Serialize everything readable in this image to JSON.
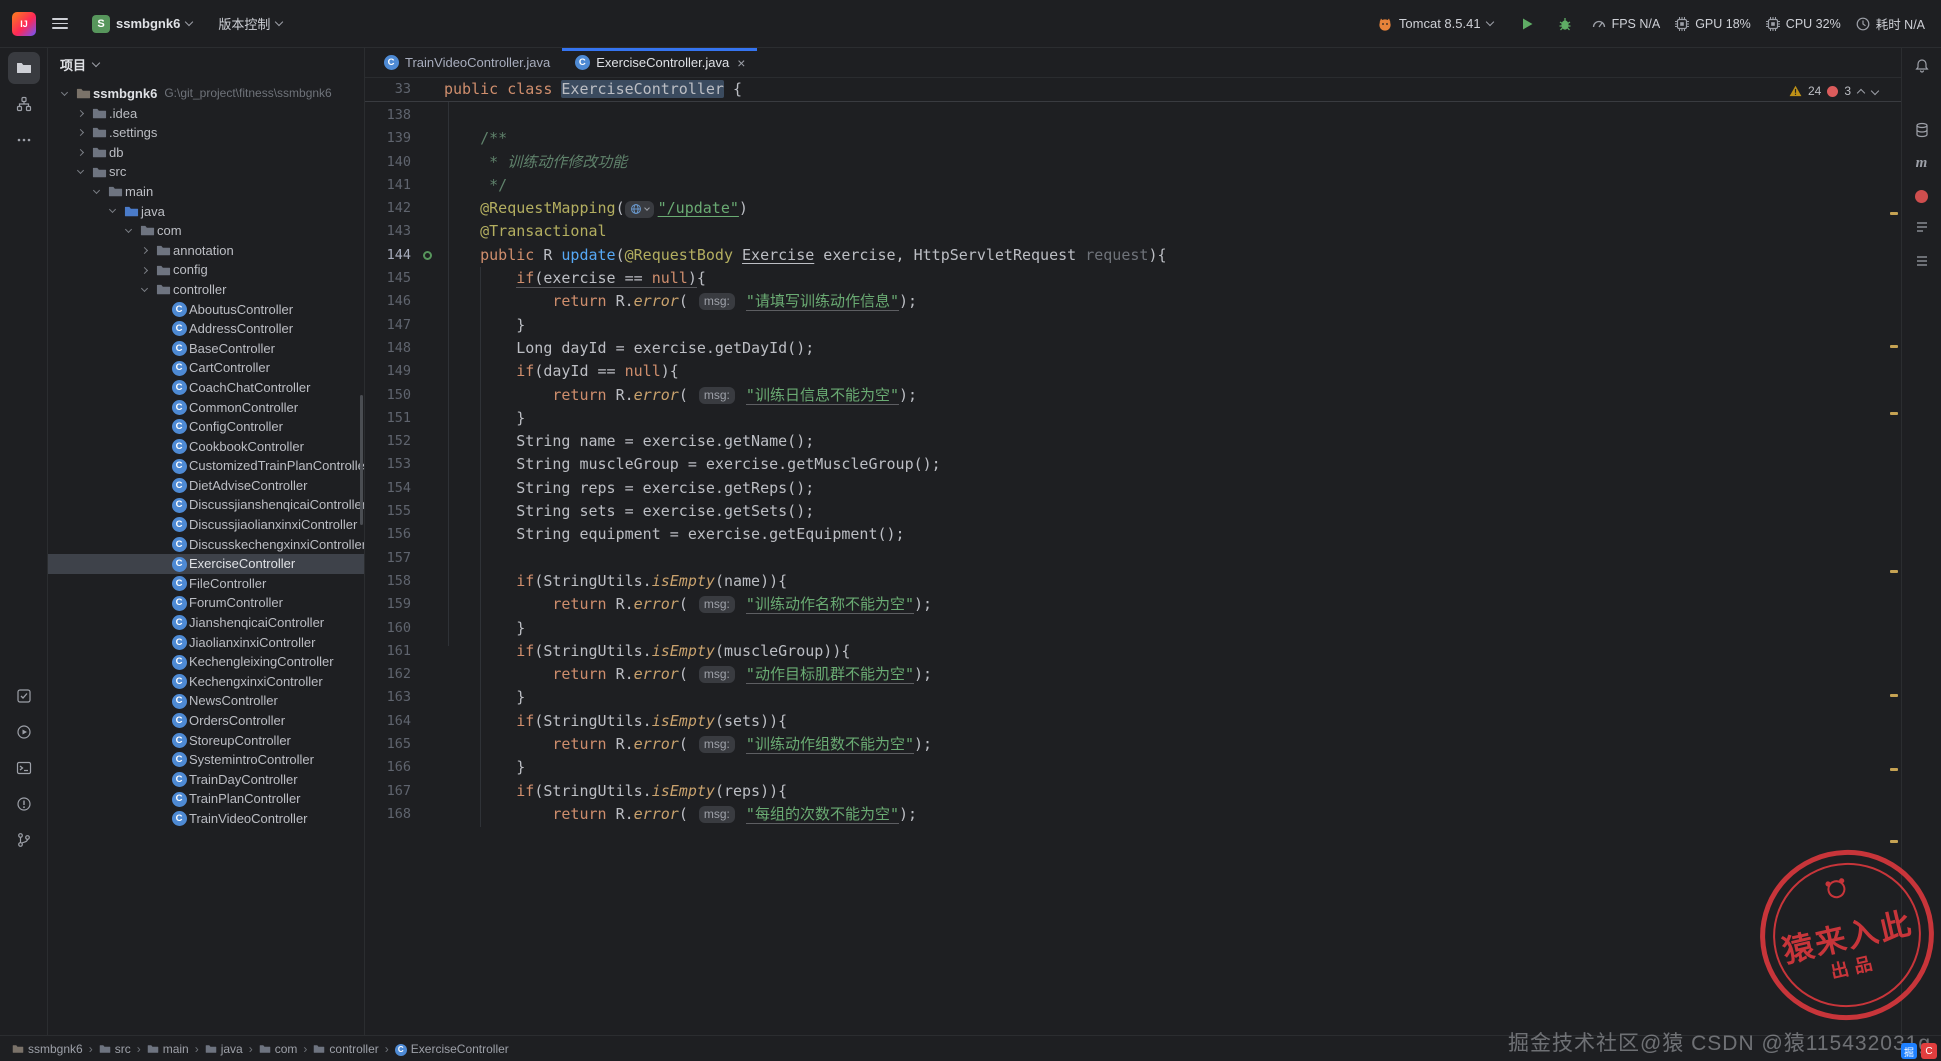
{
  "titlebar": {
    "project": "ssmbgnk6",
    "project_initial": "S",
    "vcs": "版本控制",
    "run_config": "Tomcat 8.5.41",
    "metrics": {
      "fps": "FPS N/A",
      "gpu": "GPU 18%",
      "cpu": "CPU 32%",
      "time": "耗时 N/A"
    }
  },
  "project_panel": {
    "header": "项目",
    "tree": [
      {
        "label": "ssmbgnk6",
        "lvl": 0,
        "icon": "module",
        "ch": "v",
        "bold": true,
        "extra": "G:\\git_project\\fitness\\ssmbgnk6"
      },
      {
        "label": ".idea",
        "lvl": 1,
        "icon": "folder",
        "ch": ">"
      },
      {
        "label": ".settings",
        "lvl": 1,
        "icon": "folder",
        "ch": ">"
      },
      {
        "label": "db",
        "lvl": 1,
        "icon": "folder",
        "ch": ">"
      },
      {
        "label": "src",
        "lvl": 1,
        "icon": "folder",
        "ch": "v"
      },
      {
        "label": "main",
        "lvl": 2,
        "icon": "folder",
        "ch": "v"
      },
      {
        "label": "java",
        "lvl": 3,
        "icon": "srcfolder",
        "ch": "v"
      },
      {
        "label": "com",
        "lvl": 4,
        "icon": "folder",
        "ch": "v"
      },
      {
        "label": "annotation",
        "lvl": 5,
        "icon": "folder",
        "ch": ">"
      },
      {
        "label": "config",
        "lvl": 5,
        "icon": "folder",
        "ch": ">"
      },
      {
        "label": "controller",
        "lvl": 5,
        "icon": "folder",
        "ch": "v"
      },
      {
        "label": "AboutusController",
        "lvl": 6,
        "icon": "class"
      },
      {
        "label": "AddressController",
        "lvl": 6,
        "icon": "class"
      },
      {
        "label": "BaseController",
        "lvl": 6,
        "icon": "class"
      },
      {
        "label": "CartController",
        "lvl": 6,
        "icon": "class"
      },
      {
        "label": "CoachChatController",
        "lvl": 6,
        "icon": "class"
      },
      {
        "label": "CommonController",
        "lvl": 6,
        "icon": "class"
      },
      {
        "label": "ConfigController",
        "lvl": 6,
        "icon": "class"
      },
      {
        "label": "CookbookController",
        "lvl": 6,
        "icon": "class"
      },
      {
        "label": "CustomizedTrainPlanController",
        "lvl": 6,
        "icon": "class"
      },
      {
        "label": "DietAdviseController",
        "lvl": 6,
        "icon": "class"
      },
      {
        "label": "DiscussjianshenqicaiController",
        "lvl": 6,
        "icon": "class"
      },
      {
        "label": "DiscussjiaolianxinxiController",
        "lvl": 6,
        "icon": "class"
      },
      {
        "label": "DiscusskechengxinxiController",
        "lvl": 6,
        "icon": "class"
      },
      {
        "label": "ExerciseController",
        "lvl": 6,
        "icon": "class",
        "sel": true
      },
      {
        "label": "FileController",
        "lvl": 6,
        "icon": "class"
      },
      {
        "label": "ForumController",
        "lvl": 6,
        "icon": "class"
      },
      {
        "label": "JianshenqicaiController",
        "lvl": 6,
        "icon": "class"
      },
      {
        "label": "JiaolianxinxiController",
        "lvl": 6,
        "icon": "class"
      },
      {
        "label": "KechengleixingController",
        "lvl": 6,
        "icon": "class"
      },
      {
        "label": "KechengxinxiController",
        "lvl": 6,
        "icon": "class"
      },
      {
        "label": "NewsController",
        "lvl": 6,
        "icon": "class"
      },
      {
        "label": "OrdersController",
        "lvl": 6,
        "icon": "class"
      },
      {
        "label": "StoreupController",
        "lvl": 6,
        "icon": "class"
      },
      {
        "label": "SystemintroController",
        "lvl": 6,
        "icon": "class"
      },
      {
        "label": "TrainDayController",
        "lvl": 6,
        "icon": "class"
      },
      {
        "label": "TrainPlanController",
        "lvl": 6,
        "icon": "class"
      },
      {
        "label": "TrainVideoController",
        "lvl": 6,
        "icon": "class"
      }
    ]
  },
  "tabs": [
    {
      "label": "TrainVideoController.java",
      "active": false
    },
    {
      "label": "ExerciseController.java",
      "active": true
    }
  ],
  "editor": {
    "inspections": {
      "warnings": "24",
      "errors": "3"
    },
    "sticky": {
      "n": "33",
      "s": [
        [
          "public",
          "k"
        ],
        [
          " ",
          "d"
        ],
        [
          "class",
          "k"
        ],
        [
          " ",
          "d"
        ],
        [
          "ExerciseController",
          "d hl"
        ],
        [
          " {",
          "d"
        ]
      ]
    },
    "stripe_marks": [
      164,
      297,
      364,
      522,
      646,
      720,
      792
    ],
    "lines": [
      {
        "n": "138",
        "s": []
      },
      {
        "n": "139",
        "s": [
          [
            "    /**",
            "dc"
          ]
        ]
      },
      {
        "n": "140",
        "s": [
          [
            "     * 训练动作修改功能",
            "dc it"
          ]
        ]
      },
      {
        "n": "141",
        "s": [
          [
            "     */",
            "dc"
          ]
        ]
      },
      {
        "n": "142",
        "s": [
          [
            "    ",
            "d"
          ],
          [
            "@RequestMapping",
            "a"
          ],
          [
            "(",
            "d"
          ],
          [
            "",
            "globe"
          ],
          [
            "\"/update\"",
            "s lu"
          ],
          [
            ")",
            "d"
          ]
        ]
      },
      {
        "n": "143",
        "s": [
          [
            "    ",
            "d"
          ],
          [
            "@Transactional",
            "a"
          ]
        ]
      },
      {
        "n": "144",
        "g": "run",
        "s": [
          [
            "    ",
            "d"
          ],
          [
            "public",
            "k"
          ],
          [
            " R ",
            "d"
          ],
          [
            "update",
            "m"
          ],
          [
            "(",
            "d"
          ],
          [
            "@RequestBody",
            "a"
          ],
          [
            " ",
            "d"
          ],
          [
            "Exercise",
            "d lu"
          ],
          [
            " exercise, HttpServletRequest ",
            "d"
          ],
          [
            "request",
            "dim"
          ],
          [
            "){",
            "d"
          ]
        ]
      },
      {
        "n": "145",
        "s": [
          [
            "        ",
            "d"
          ],
          [
            "if",
            "k ulw"
          ],
          [
            "(exercise == ",
            "d ulw"
          ],
          [
            "null",
            "k ulw"
          ],
          [
            ")",
            "d ulw"
          ],
          [
            "{",
            "d"
          ]
        ]
      },
      {
        "n": "146",
        "s": [
          [
            "            ",
            "d"
          ],
          [
            "return",
            "k"
          ],
          [
            " R.",
            "d"
          ],
          [
            "error",
            "sm"
          ],
          [
            "( ",
            "d"
          ],
          [
            "msg:",
            "hint"
          ],
          [
            " ",
            "d"
          ],
          [
            "\"请填写训练动作信息\"",
            "s su"
          ],
          [
            ");",
            "d"
          ]
        ]
      },
      {
        "n": "147",
        "s": [
          [
            "        }",
            "d"
          ]
        ]
      },
      {
        "n": "148",
        "s": [
          [
            "        Long dayId = exercise.getDayId();",
            "d"
          ]
        ]
      },
      {
        "n": "149",
        "s": [
          [
            "        ",
            "d"
          ],
          [
            "if",
            "k"
          ],
          [
            "(dayId == ",
            "d"
          ],
          [
            "null",
            "k"
          ],
          [
            "){",
            "d"
          ]
        ]
      },
      {
        "n": "150",
        "s": [
          [
            "            ",
            "d"
          ],
          [
            "return",
            "k"
          ],
          [
            " R.",
            "d"
          ],
          [
            "error",
            "sm"
          ],
          [
            "( ",
            "d"
          ],
          [
            "msg:",
            "hint"
          ],
          [
            " ",
            "d"
          ],
          [
            "\"训练日信息不能为空\"",
            "s su"
          ],
          [
            ");",
            "d"
          ]
        ]
      },
      {
        "n": "151",
        "s": [
          [
            "        }",
            "d"
          ]
        ]
      },
      {
        "n": "152",
        "s": [
          [
            "        String name = exercise.getName();",
            "d"
          ]
        ]
      },
      {
        "n": "153",
        "s": [
          [
            "        String muscleGroup = exercise.getMuscleGroup();",
            "d"
          ]
        ]
      },
      {
        "n": "154",
        "s": [
          [
            "        String reps = exercise.getReps();",
            "d"
          ]
        ]
      },
      {
        "n": "155",
        "s": [
          [
            "        String sets = exercise.getSets();",
            "d"
          ]
        ]
      },
      {
        "n": "156",
        "s": [
          [
            "        String equipment = exercise.getEquipment();",
            "d"
          ]
        ]
      },
      {
        "n": "157",
        "s": []
      },
      {
        "n": "158",
        "s": [
          [
            "        ",
            "d"
          ],
          [
            "if",
            "k"
          ],
          [
            "(StringUtils.",
            "d"
          ],
          [
            "isEmpty",
            "sm"
          ],
          [
            "(name)){",
            "d"
          ]
        ]
      },
      {
        "n": "159",
        "s": [
          [
            "            ",
            "d"
          ],
          [
            "return",
            "k"
          ],
          [
            " R.",
            "d"
          ],
          [
            "error",
            "sm"
          ],
          [
            "( ",
            "d"
          ],
          [
            "msg:",
            "hint"
          ],
          [
            " ",
            "d"
          ],
          [
            "\"训练动作名称不能为空\"",
            "s su"
          ],
          [
            ");",
            "d"
          ]
        ]
      },
      {
        "n": "160",
        "s": [
          [
            "        }",
            "d"
          ]
        ]
      },
      {
        "n": "161",
        "s": [
          [
            "        ",
            "d"
          ],
          [
            "if",
            "k"
          ],
          [
            "(StringUtils.",
            "d"
          ],
          [
            "isEmpty",
            "sm"
          ],
          [
            "(muscleGroup)){",
            "d"
          ]
        ]
      },
      {
        "n": "162",
        "s": [
          [
            "            ",
            "d"
          ],
          [
            "return",
            "k"
          ],
          [
            " R.",
            "d"
          ],
          [
            "error",
            "sm"
          ],
          [
            "( ",
            "d"
          ],
          [
            "msg:",
            "hint"
          ],
          [
            " ",
            "d"
          ],
          [
            "\"动作目标肌群不能为空\"",
            "s su"
          ],
          [
            ");",
            "d"
          ]
        ]
      },
      {
        "n": "163",
        "s": [
          [
            "        }",
            "d"
          ]
        ]
      },
      {
        "n": "164",
        "s": [
          [
            "        ",
            "d"
          ],
          [
            "if",
            "k"
          ],
          [
            "(StringUtils.",
            "d"
          ],
          [
            "isEmpty",
            "sm"
          ],
          [
            "(sets)){",
            "d"
          ]
        ]
      },
      {
        "n": "165",
        "s": [
          [
            "            ",
            "d"
          ],
          [
            "return",
            "k"
          ],
          [
            " R.",
            "d"
          ],
          [
            "error",
            "sm"
          ],
          [
            "( ",
            "d"
          ],
          [
            "msg:",
            "hint"
          ],
          [
            " ",
            "d"
          ],
          [
            "\"训练动作组数不能为空\"",
            "s su"
          ],
          [
            ");",
            "d"
          ]
        ]
      },
      {
        "n": "166",
        "s": [
          [
            "        }",
            "d"
          ]
        ]
      },
      {
        "n": "167",
        "s": [
          [
            "        ",
            "d"
          ],
          [
            "if",
            "k"
          ],
          [
            "(StringUtils.",
            "d"
          ],
          [
            "isEmpty",
            "sm"
          ],
          [
            "(reps)){",
            "d"
          ]
        ]
      },
      {
        "n": "168",
        "s": [
          [
            "            ",
            "d"
          ],
          [
            "return",
            "k"
          ],
          [
            " R.",
            "d"
          ],
          [
            "error",
            "sm"
          ],
          [
            "( ",
            "d"
          ],
          [
            "msg:",
            "hint"
          ],
          [
            " ",
            "d"
          ],
          [
            "\"每组的次数不能为空\"",
            "s su"
          ],
          [
            ");",
            "d"
          ]
        ]
      }
    ]
  },
  "breadcrumbs": [
    {
      "label": "ssmbgnk6",
      "icon": "module"
    },
    {
      "label": "src",
      "icon": "folder"
    },
    {
      "label": "main",
      "icon": "folder"
    },
    {
      "label": "java",
      "icon": "folder"
    },
    {
      "label": "com",
      "icon": "folder"
    },
    {
      "label": "controller",
      "icon": "folder"
    },
    {
      "label": "ExerciseController",
      "icon": "class"
    }
  ],
  "watermark": {
    "stamp_main": "猿来入此",
    "stamp_sub": "出品",
    "text": "掘金技术社区@猿 CSDN @猿115432031g",
    "logo1": "掘",
    "logo2": "C"
  }
}
